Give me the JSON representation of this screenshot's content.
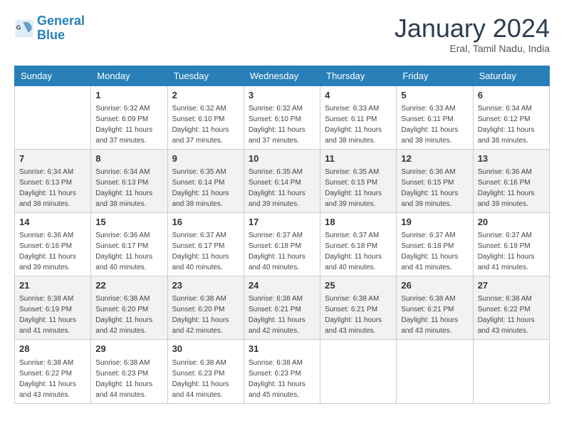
{
  "header": {
    "logo_line1": "General",
    "logo_line2": "Blue",
    "month": "January 2024",
    "location": "Eral, Tamil Nadu, India"
  },
  "days_of_week": [
    "Sunday",
    "Monday",
    "Tuesday",
    "Wednesday",
    "Thursday",
    "Friday",
    "Saturday"
  ],
  "weeks": [
    [
      {
        "day": "",
        "sunrise": "",
        "sunset": "",
        "daylight": ""
      },
      {
        "day": "1",
        "sunrise": "6:32 AM",
        "sunset": "6:09 PM",
        "daylight": "11 hours and 37 minutes."
      },
      {
        "day": "2",
        "sunrise": "6:32 AM",
        "sunset": "6:10 PM",
        "daylight": "11 hours and 37 minutes."
      },
      {
        "day": "3",
        "sunrise": "6:32 AM",
        "sunset": "6:10 PM",
        "daylight": "11 hours and 37 minutes."
      },
      {
        "day": "4",
        "sunrise": "6:33 AM",
        "sunset": "6:11 PM",
        "daylight": "11 hours and 38 minutes."
      },
      {
        "day": "5",
        "sunrise": "6:33 AM",
        "sunset": "6:11 PM",
        "daylight": "11 hours and 38 minutes."
      },
      {
        "day": "6",
        "sunrise": "6:34 AM",
        "sunset": "6:12 PM",
        "daylight": "11 hours and 38 minutes."
      }
    ],
    [
      {
        "day": "7",
        "sunrise": "6:34 AM",
        "sunset": "6:13 PM",
        "daylight": "11 hours and 38 minutes."
      },
      {
        "day": "8",
        "sunrise": "6:34 AM",
        "sunset": "6:13 PM",
        "daylight": "11 hours and 38 minutes."
      },
      {
        "day": "9",
        "sunrise": "6:35 AM",
        "sunset": "6:14 PM",
        "daylight": "11 hours and 38 minutes."
      },
      {
        "day": "10",
        "sunrise": "6:35 AM",
        "sunset": "6:14 PM",
        "daylight": "11 hours and 39 minutes."
      },
      {
        "day": "11",
        "sunrise": "6:35 AM",
        "sunset": "6:15 PM",
        "daylight": "11 hours and 39 minutes."
      },
      {
        "day": "12",
        "sunrise": "6:36 AM",
        "sunset": "6:15 PM",
        "daylight": "11 hours and 39 minutes."
      },
      {
        "day": "13",
        "sunrise": "6:36 AM",
        "sunset": "6:16 PM",
        "daylight": "11 hours and 39 minutes."
      }
    ],
    [
      {
        "day": "14",
        "sunrise": "6:36 AM",
        "sunset": "6:16 PM",
        "daylight": "11 hours and 39 minutes."
      },
      {
        "day": "15",
        "sunrise": "6:36 AM",
        "sunset": "6:17 PM",
        "daylight": "11 hours and 40 minutes."
      },
      {
        "day": "16",
        "sunrise": "6:37 AM",
        "sunset": "6:17 PM",
        "daylight": "11 hours and 40 minutes."
      },
      {
        "day": "17",
        "sunrise": "6:37 AM",
        "sunset": "6:18 PM",
        "daylight": "11 hours and 40 minutes."
      },
      {
        "day": "18",
        "sunrise": "6:37 AM",
        "sunset": "6:18 PM",
        "daylight": "11 hours and 40 minutes."
      },
      {
        "day": "19",
        "sunrise": "6:37 AM",
        "sunset": "6:18 PM",
        "daylight": "11 hours and 41 minutes."
      },
      {
        "day": "20",
        "sunrise": "6:37 AM",
        "sunset": "6:19 PM",
        "daylight": "11 hours and 41 minutes."
      }
    ],
    [
      {
        "day": "21",
        "sunrise": "6:38 AM",
        "sunset": "6:19 PM",
        "daylight": "11 hours and 41 minutes."
      },
      {
        "day": "22",
        "sunrise": "6:38 AM",
        "sunset": "6:20 PM",
        "daylight": "11 hours and 42 minutes."
      },
      {
        "day": "23",
        "sunrise": "6:38 AM",
        "sunset": "6:20 PM",
        "daylight": "11 hours and 42 minutes."
      },
      {
        "day": "24",
        "sunrise": "6:38 AM",
        "sunset": "6:21 PM",
        "daylight": "11 hours and 42 minutes."
      },
      {
        "day": "25",
        "sunrise": "6:38 AM",
        "sunset": "6:21 PM",
        "daylight": "11 hours and 43 minutes."
      },
      {
        "day": "26",
        "sunrise": "6:38 AM",
        "sunset": "6:21 PM",
        "daylight": "11 hours and 43 minutes."
      },
      {
        "day": "27",
        "sunrise": "6:38 AM",
        "sunset": "6:22 PM",
        "daylight": "11 hours and 43 minutes."
      }
    ],
    [
      {
        "day": "28",
        "sunrise": "6:38 AM",
        "sunset": "6:22 PM",
        "daylight": "11 hours and 43 minutes."
      },
      {
        "day": "29",
        "sunrise": "6:38 AM",
        "sunset": "6:23 PM",
        "daylight": "11 hours and 44 minutes."
      },
      {
        "day": "30",
        "sunrise": "6:38 AM",
        "sunset": "6:23 PM",
        "daylight": "11 hours and 44 minutes."
      },
      {
        "day": "31",
        "sunrise": "6:38 AM",
        "sunset": "6:23 PM",
        "daylight": "11 hours and 45 minutes."
      },
      {
        "day": "",
        "sunrise": "",
        "sunset": "",
        "daylight": ""
      },
      {
        "day": "",
        "sunrise": "",
        "sunset": "",
        "daylight": ""
      },
      {
        "day": "",
        "sunrise": "",
        "sunset": "",
        "daylight": ""
      }
    ]
  ],
  "labels": {
    "sunrise": "Sunrise:",
    "sunset": "Sunset:",
    "daylight": "Daylight:"
  }
}
